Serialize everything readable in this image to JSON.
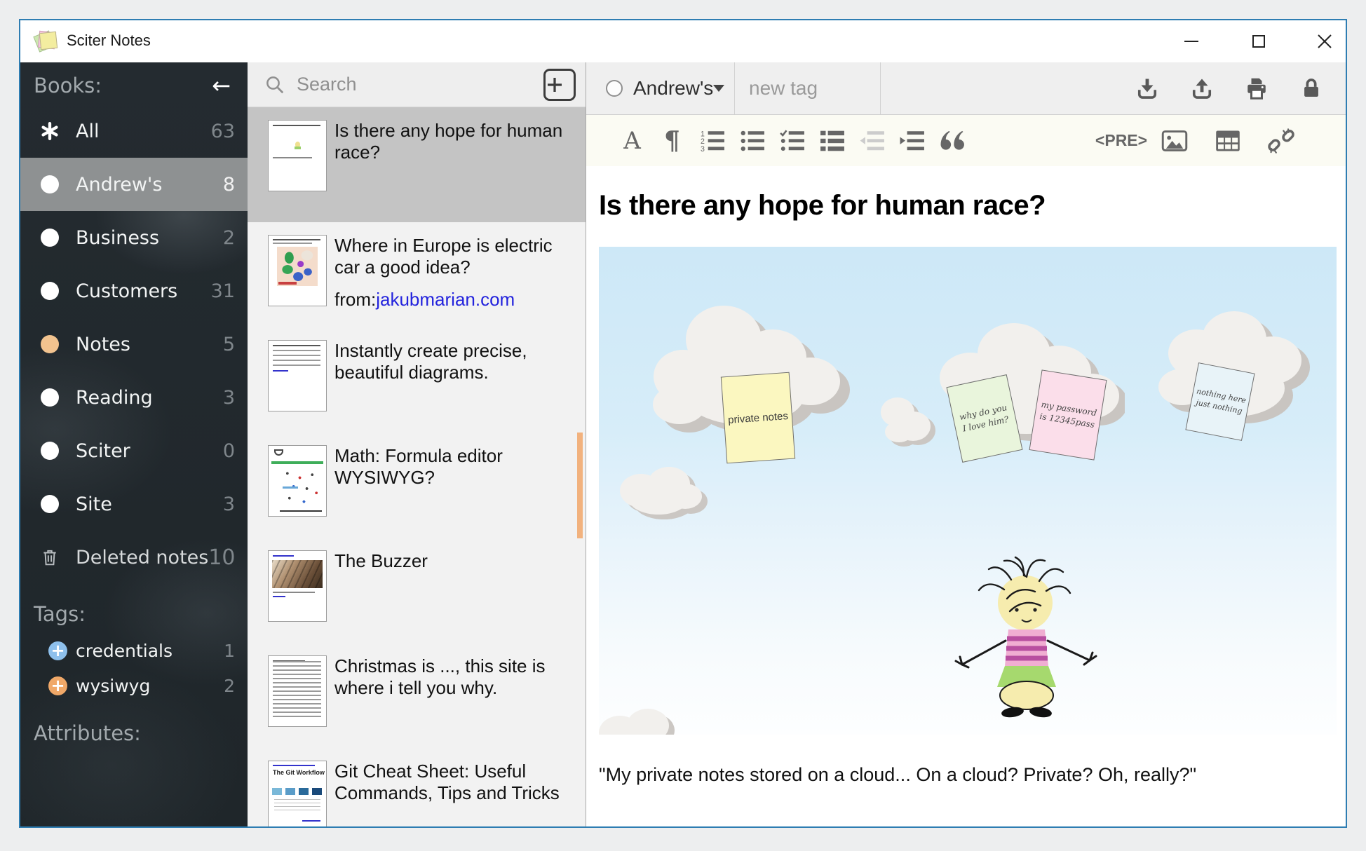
{
  "window": {
    "title": "Sciter Notes",
    "controls": [
      "minimize",
      "maximize",
      "close"
    ]
  },
  "sidebar": {
    "books_header": "Books:",
    "collapse_icon": "arrow-left",
    "books": [
      {
        "label": "All",
        "count": "63",
        "icon": "asterisk"
      },
      {
        "label": "Andrew's",
        "count": "8",
        "icon": "circle-white",
        "selected": true
      },
      {
        "label": "Business",
        "count": "2",
        "icon": "circle-white"
      },
      {
        "label": "Customers",
        "count": "31",
        "icon": "circle-white"
      },
      {
        "label": "Notes",
        "count": "5",
        "icon": "circle-orange"
      },
      {
        "label": "Reading",
        "count": "3",
        "icon": "circle-white"
      },
      {
        "label": "Sciter",
        "count": "0",
        "icon": "circle-white"
      },
      {
        "label": "Site",
        "count": "3",
        "icon": "circle-white"
      },
      {
        "label": "Deleted notes",
        "count": "10",
        "icon": "trash"
      }
    ],
    "tags_header": "Tags:",
    "tags": [
      {
        "label": "credentials",
        "count": "1",
        "icon": "plus-circle-blue"
      },
      {
        "label": "wysiwyg",
        "count": "2",
        "icon": "plus-circle-orange"
      }
    ],
    "attributes_header": "Attributes:"
  },
  "list": {
    "search_placeholder": "Search",
    "items": [
      {
        "title": "Is there any hope for human race?",
        "selected": true
      },
      {
        "title": "Where in Europe is electric car a good idea?",
        "from_label": "from:",
        "link": "jakubmarian.com"
      },
      {
        "title": "Instantly create precise, beautiful diagrams."
      },
      {
        "title": "Math: Formula editor WYSIWYG?"
      },
      {
        "title": "The Buzzer"
      },
      {
        "title": "Christmas is ..., this site is where i tell you why."
      },
      {
        "title": "Git Cheat Sheet: Useful Commands, Tips and Tricks",
        "thumb_text": "The Git Workflow"
      }
    ]
  },
  "editor": {
    "book_selector": "Andrew's",
    "new_tag_placeholder": "new tag",
    "icon_font_label": "A",
    "icon_paragraph": "¶",
    "pre_label": "<PRE>",
    "format_toolbar": [
      "font",
      "paragraph",
      "ordered-list",
      "bullet-list",
      "check-list",
      "block-list",
      "outdent",
      "indent",
      "blockquote",
      "pre",
      "image",
      "table",
      "unlink"
    ],
    "top_icons": [
      "download",
      "upload",
      "print",
      "lock"
    ],
    "note_title": "Is there any hope for human race?",
    "sticky_notes": [
      {
        "lines": [
          "private notes"
        ],
        "color": "#fbf7c0"
      },
      {
        "lines": [
          "why do you",
          "I love him?"
        ],
        "color": "#e9f5dc"
      },
      {
        "lines": [
          "my password",
          "is 12345pass"
        ],
        "color": "#fbdeea"
      },
      {
        "lines": [
          "nothing here",
          "just nothing"
        ],
        "color": "#e8f3f8"
      }
    ],
    "quote": "\"My private notes stored on a cloud... On a cloud? Private? Oh, really?\""
  },
  "colors": {
    "window_border": "#2e7db2",
    "sidebar_bg": "#242b30",
    "selected_row": "#8e9192",
    "accent_orange": "#f2b27e",
    "link_blue": "#2323dd",
    "tag_blue": "#8ec0ec",
    "tag_orange": "#f0a868",
    "notes_dot_orange": "#f2c38f"
  }
}
